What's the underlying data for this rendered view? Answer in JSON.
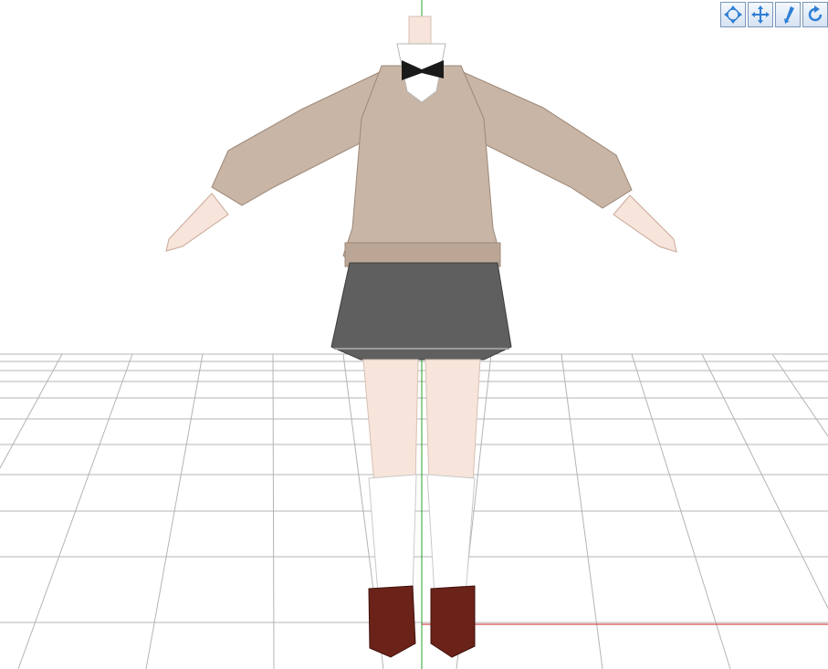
{
  "viewport": {
    "background": "#ffffff",
    "grid_color": "#b4b4b4",
    "axis_y_color": "#2aa02a",
    "axis_x_color": "#cc2222",
    "model": {
      "sweater_color": "#c9b5a5",
      "skirt_color": "#5f5f5f",
      "sock_color": "#ffffff",
      "shoe_color": "#6b2218",
      "skin_color": "#f7e4da",
      "bow_color": "#1a1a1a"
    }
  },
  "toolbar": {
    "accent": "#2f7fd4",
    "buttons": [
      {
        "icon": "rotate-view-icon"
      },
      {
        "icon": "move-view-icon"
      },
      {
        "icon": "zoom-view-icon"
      },
      {
        "icon": "reset-view-icon"
      }
    ]
  }
}
